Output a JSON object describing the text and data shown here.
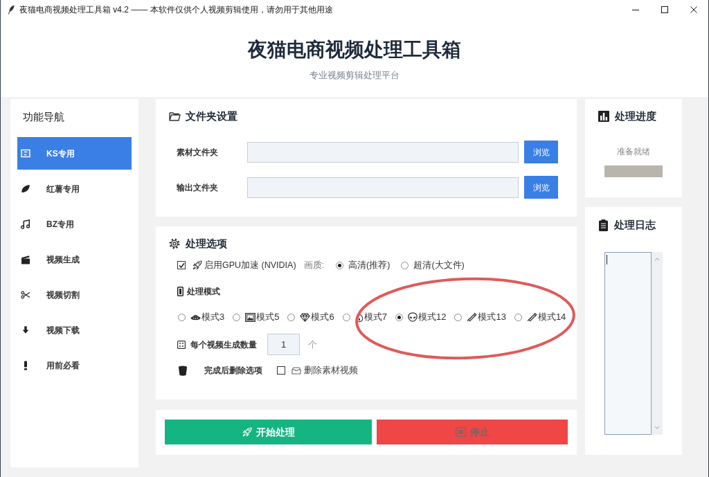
{
  "window": {
    "title": "夜猫电商视频处理工具箱 v4.2 —— 本软件仅供个人视频剪辑使用，请勿用于其他用途"
  },
  "header": {
    "title": "夜猫电商视频处理工具箱",
    "subtitle": "专业视频剪辑处理平台"
  },
  "sidebar": {
    "title": "功能导航",
    "items": [
      {
        "label": "KS专用",
        "selected": true
      },
      {
        "label": "红薯专用",
        "selected": false
      },
      {
        "label": "BZ专用",
        "selected": false
      },
      {
        "label": "视频生成",
        "selected": false
      },
      {
        "label": "视频切割",
        "selected": false
      },
      {
        "label": "视频下载",
        "selected": false
      },
      {
        "label": "用前必看",
        "selected": false
      }
    ]
  },
  "folder_settings": {
    "title": "文件夹设置",
    "rows": [
      {
        "label": "素材文件夹",
        "button": "浏览"
      },
      {
        "label": "输出文件夹",
        "button": "浏览"
      }
    ]
  },
  "options": {
    "title": "处理选项",
    "gpu": {
      "label": "启用GPU加速 (NVIDIA)",
      "checked": true
    },
    "quality": {
      "label": "画质:",
      "choices": [
        {
          "label": "高清(推荐)",
          "selected": true
        },
        {
          "label": "超清(大文件)",
          "selected": false
        }
      ]
    },
    "mode": {
      "label": "处理模式",
      "choices": [
        {
          "label": "模式3",
          "selected": false
        },
        {
          "label": "模式5",
          "selected": false
        },
        {
          "label": "模式6",
          "selected": false
        },
        {
          "label": "模式7",
          "selected": false
        },
        {
          "label": "模式12",
          "selected": true
        },
        {
          "label": "模式13",
          "selected": false
        },
        {
          "label": "模式14",
          "selected": false
        }
      ]
    },
    "count": {
      "label": "每个视频生成数量",
      "value": "1",
      "unit": "个"
    },
    "delete": {
      "label": "完成后删除选项",
      "option": {
        "label": "删除素材视频",
        "checked": false
      }
    }
  },
  "actions": [
    {
      "kind": "start",
      "label": "开始处理",
      "disabled": false
    },
    {
      "kind": "stop",
      "label": "停止",
      "disabled": true
    }
  ],
  "progress": {
    "title": "处理进度",
    "status": "准备就绪",
    "level": 0
  },
  "log": {
    "title": "处理日志"
  },
  "annotations": [
    {
      "kind": "ellipse"
    }
  ]
}
